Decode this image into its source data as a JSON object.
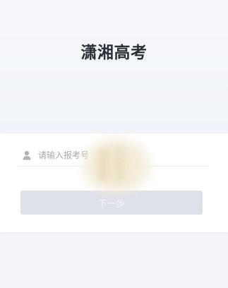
{
  "app": {
    "title": "潇湘高考"
  },
  "login_form": {
    "exam_number_input": {
      "placeholder": "请输入报考号",
      "value": ""
    },
    "next_button_label": "下一步"
  },
  "icons": {
    "input_icon": "user-icon"
  },
  "colors": {
    "title_text": "#2b2f36",
    "button_bg": "#dfe1ea",
    "placeholder_text": "#a9a9a9",
    "page_bg": "#f2f4f9"
  }
}
